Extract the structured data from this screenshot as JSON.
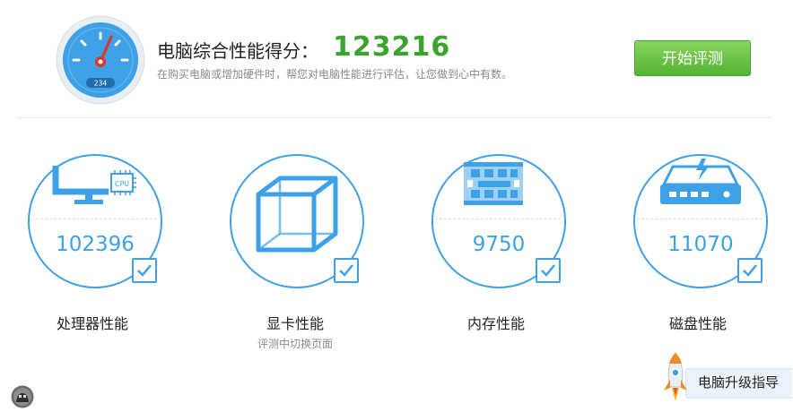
{
  "header": {
    "title": "电脑综合性能得分：",
    "score": "123216",
    "subtitle": "在购买电脑或增加硬件时，帮您对电脑性能进行评估，让您做到心中有数。",
    "start_button": "开始评测",
    "gauge_digits": "234"
  },
  "cards": [
    {
      "value": "102396",
      "label": "处理器性能",
      "sub": "",
      "icon": "cpu-monitor-icon",
      "chip_text": "CPU"
    },
    {
      "value": "",
      "label": "显卡性能",
      "sub": "评测中切换页面",
      "icon": "graphics-cube-icon"
    },
    {
      "value": "9750",
      "label": "内存性能",
      "sub": "",
      "icon": "memory-chip-icon"
    },
    {
      "value": "11070",
      "label": "磁盘性能",
      "sub": "",
      "icon": "hard-disk-icon"
    }
  ],
  "upgrade": {
    "label": "电脑升级指导",
    "icon": "rocket-icon"
  },
  "colors": {
    "accent": "#3ea1e8",
    "score_green": "#3aa52c",
    "button_green": "#56b335"
  }
}
